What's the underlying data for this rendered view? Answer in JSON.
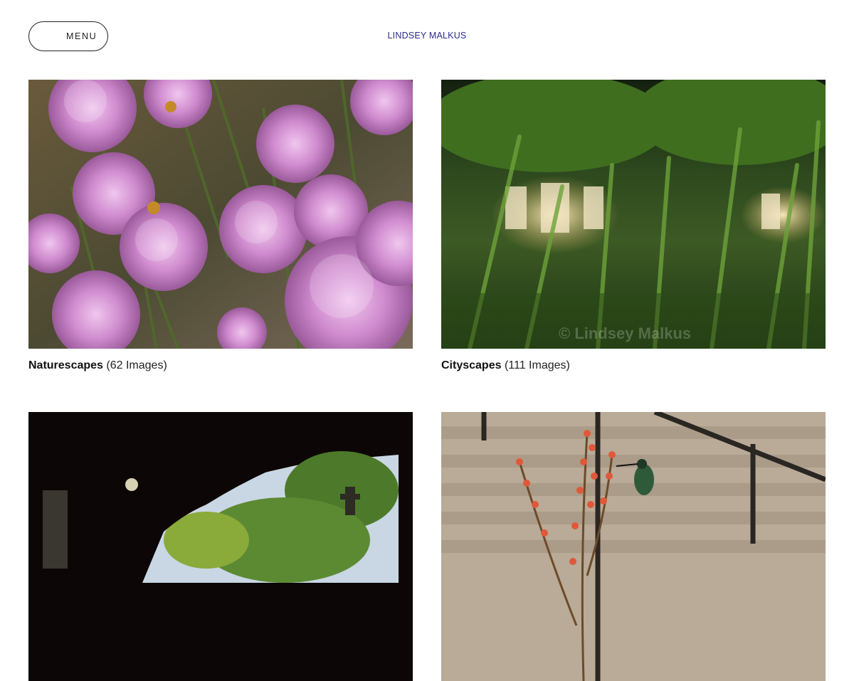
{
  "header": {
    "menu_label": "MENU",
    "site_title": "LINDSEY MALKUS"
  },
  "galleries": [
    {
      "title": "Naturescapes",
      "count": "(62 Images)"
    },
    {
      "title": "Cityscapes",
      "count": "(111 Images)",
      "watermark": "© Lindsey Malkus"
    },
    {
      "title": "",
      "count": ""
    },
    {
      "title": "",
      "count": ""
    }
  ],
  "colors": {
    "title_link": "#2b2a8c",
    "text": "#222222"
  }
}
